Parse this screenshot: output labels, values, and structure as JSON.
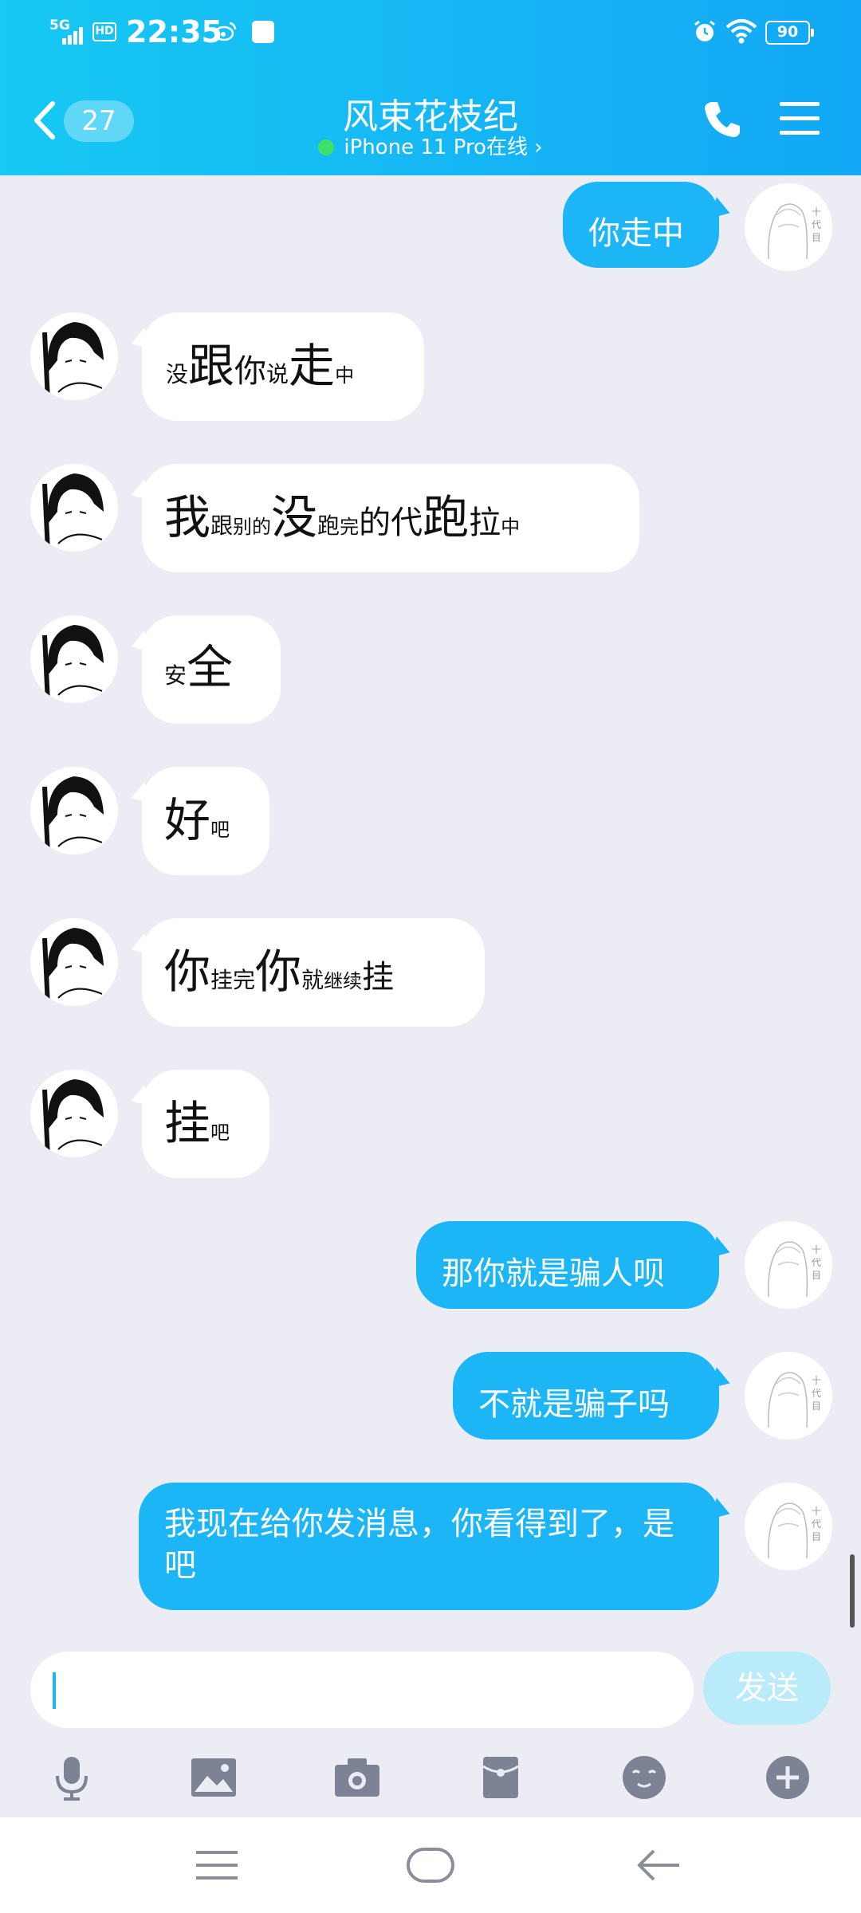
{
  "status_bar": {
    "network": "5G",
    "hd": "HD",
    "time": "22:35",
    "battery": "90"
  },
  "header": {
    "unread_count": "27",
    "title": "风束花枝纪",
    "subtitle": "iPhone 11 Pro在线",
    "chevron": "›"
  },
  "messages": [
    {
      "side": "out",
      "text": "你走中"
    },
    {
      "side": "in",
      "text": "没跟你说走中"
    },
    {
      "side": "in",
      "text": "我跟别的没跑完的代跑拉中"
    },
    {
      "side": "in",
      "text": "安全"
    },
    {
      "side": "in",
      "text": "好吧"
    },
    {
      "side": "in",
      "text": "你挂完你就继续挂"
    },
    {
      "side": "in",
      "text": "挂吧"
    },
    {
      "side": "out",
      "text": "那你就是骗人呗"
    },
    {
      "side": "out",
      "text": "不就是骗子吗"
    },
    {
      "side": "out",
      "text": "我现在给你发消息，你看得到了，是吧"
    }
  ],
  "input": {
    "placeholder": "",
    "send_label": "发送"
  },
  "toolbar_icons": [
    "microphone-icon",
    "image-icon",
    "camera-icon",
    "red-packet-icon",
    "emoji-icon",
    "plus-icon"
  ],
  "nav_icons": [
    "menu-icon",
    "home-icon",
    "back-icon"
  ],
  "colors": {
    "header_start": "#17c9f3",
    "header_end": "#12a8f5",
    "outgoing_bubble": "#1cb5f6",
    "incoming_bubble": "#ffffff",
    "chat_background": "#ececf4",
    "send_disabled": "#b9ebfb",
    "online_dot": "#3ee06a"
  }
}
